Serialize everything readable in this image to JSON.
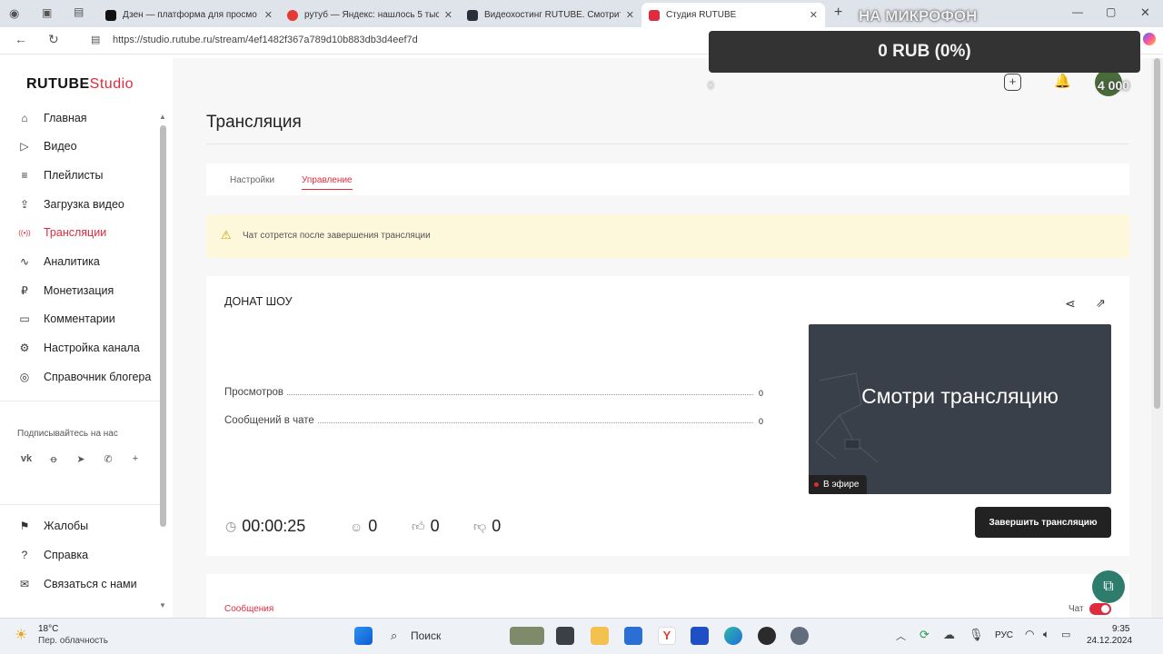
{
  "browser": {
    "tabs": [
      {
        "title": "Дзен — платформа для просмо",
        "color": "#111111"
      },
      {
        "title": "рутуб — Яндекс: нашлось 5 тыс",
        "color": "#e53935"
      },
      {
        "title": "Видеохостинг RUTUBE. Смотрит",
        "color": "#2a2d3a"
      },
      {
        "title": "Студия RUTUBE",
        "color": "#e02a3d",
        "active": true
      }
    ],
    "url": "https://studio.rutube.ru/stream/4ef1482f367a789d10b883db3d4eef7d"
  },
  "overlay": {
    "mic_label": "НА МИКРОФОН",
    "donation": "0 RUB (0%)",
    "left_counter": "0",
    "right_counter": "4 000"
  },
  "logo": {
    "brand": "RUTUBE",
    "studio": "Studio"
  },
  "sidebar": {
    "items": [
      {
        "label": "Главная",
        "icon": "home-icon",
        "glyph": "⌂"
      },
      {
        "label": "Видео",
        "icon": "video-icon",
        "glyph": "▷"
      },
      {
        "label": "Плейлисты",
        "icon": "playlist-icon",
        "glyph": "≡"
      },
      {
        "label": "Загрузка видео",
        "icon": "upload-icon",
        "glyph": "⇪"
      },
      {
        "label": "Трансляции",
        "icon": "broadcast-icon",
        "glyph": "((•))",
        "active": true
      },
      {
        "label": "Аналитика",
        "icon": "analytics-icon",
        "glyph": "∿"
      },
      {
        "label": "Монетизация",
        "icon": "money-icon",
        "glyph": "₽"
      },
      {
        "label": "Комментарии",
        "icon": "comments-icon",
        "glyph": "▭"
      },
      {
        "label": "Настройка канала",
        "icon": "settings-icon",
        "glyph": "⚙"
      },
      {
        "label": "Справочник блогера",
        "icon": "guide-icon",
        "glyph": "◎"
      }
    ],
    "subscribe_label": "Подписывайтесь на нас",
    "social": [
      "vk-icon",
      "ok-icon",
      "telegram-icon",
      "viber-icon",
      "plus-icon"
    ],
    "bottom_items": [
      {
        "label": "Жалобы",
        "icon": "flag-icon",
        "glyph": "⚑"
      },
      {
        "label": "Справка",
        "icon": "help-icon",
        "glyph": "?"
      },
      {
        "label": "Связаться с нами",
        "icon": "mail-icon",
        "glyph": "✉"
      }
    ]
  },
  "page": {
    "title": "Трансляция",
    "tabs": {
      "settings": "Настройки",
      "control": "Управление"
    },
    "warning": "Чат сотрется после завершения трансляции",
    "stream": {
      "name": "ДОНАТ ШОУ",
      "views_label": "Просмотров",
      "views_value": "0",
      "messages_label": "Сообщений в чате",
      "messages_value": "0",
      "preview_text": "Смотри трансляцию",
      "live_badge": "В эфире",
      "end_button": "Завершить трансляцию",
      "duration": "00:00:25",
      "viewers": "0",
      "likes": "0",
      "dislikes": "0"
    },
    "messages_section": "Сообщения",
    "chat_toggle_label": "Чат",
    "chat_enabled": true
  },
  "taskbar": {
    "weather_temp": "18°C",
    "weather_desc": "Пер. облачность",
    "search": "Поиск",
    "lang": "РУС",
    "time": "9:35",
    "date": "24.12.2024"
  }
}
